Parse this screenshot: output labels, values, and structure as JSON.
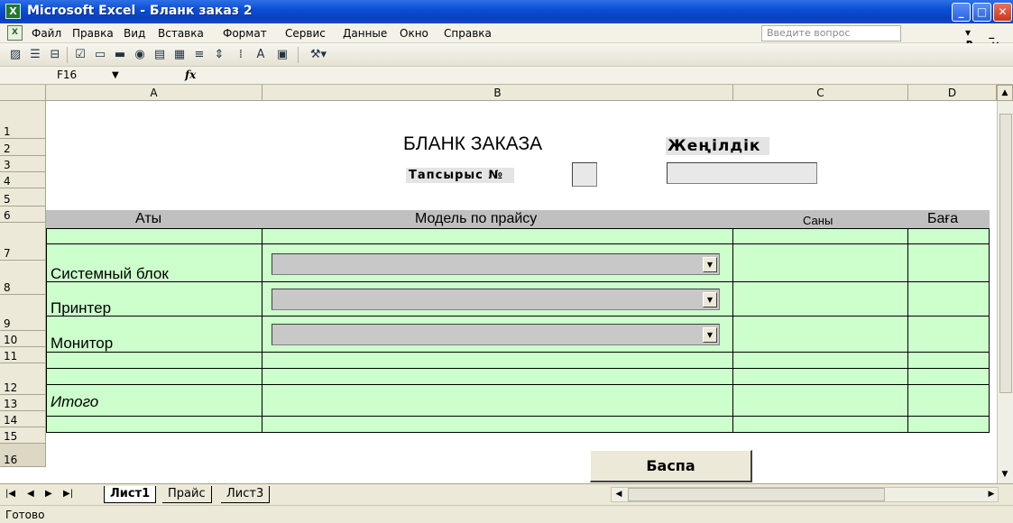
{
  "window": {
    "title": "Microsoft Excel - Бланк заказ 2",
    "app_icon": "excel-icon",
    "controls": {
      "minimize": "_",
      "maximize": "□",
      "close": "✕"
    }
  },
  "menu": {
    "items": [
      "Файл",
      "Правка",
      "Вид",
      "Вставка",
      "Формат",
      "Сервис",
      "Данные",
      "Окно",
      "Справка"
    ],
    "question_placeholder": "Введите вопрос",
    "doc_controls": "▾ _ ₽ ×"
  },
  "toolbar": {
    "icons": [
      "chart-icon",
      "properties-icon",
      "code-icon",
      "checkbox-icon",
      "textfield-icon",
      "button-icon",
      "radio-icon",
      "listbox-icon",
      "combobox-icon",
      "scrollbar-icon",
      "spinner-icon",
      "label-icon",
      "font-icon",
      "image-icon",
      "tools-icon"
    ]
  },
  "formula_bar": {
    "name_box": "F16",
    "fx_label": "fx"
  },
  "columns": [
    "A",
    "B",
    "C",
    "D"
  ],
  "rows": [
    "1",
    "2",
    "3",
    "4",
    "5",
    "6",
    "7",
    "8",
    "9",
    "10",
    "11",
    "12",
    "13",
    "14",
    "15",
    "16"
  ],
  "form": {
    "title": "БЛАНК ЗАКАЗА",
    "order_label": "Тапсырыс №",
    "discount_label": "Жеңілдік",
    "headers": {
      "name": "Аты",
      "model": "Модель по прайсу",
      "qty": "Саны",
      "price": "Баға"
    },
    "items": [
      "Системный блок",
      "Принтер",
      "Монитор"
    ],
    "total_label": "Итого",
    "print_button": "Баспа"
  },
  "sheets": {
    "tabs": [
      "Лист1",
      "Прайс",
      "Лист3"
    ],
    "active": "Лист1"
  },
  "status": {
    "text": "Готово"
  },
  "colors": {
    "green_fill": "#ccffcc",
    "header_gray": "#c0c0c0",
    "title_blue": "#0a4fd6"
  }
}
